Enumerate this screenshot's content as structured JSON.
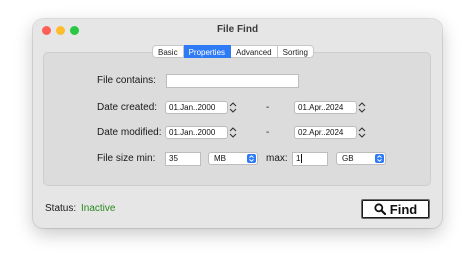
{
  "window": {
    "title": "File Find"
  },
  "tabs": [
    {
      "label": "Basic",
      "active": false
    },
    {
      "label": "Properties",
      "active": true
    },
    {
      "label": "Advanced",
      "active": false
    },
    {
      "label": "Sorting",
      "active": false
    }
  ],
  "form": {
    "file_contains": {
      "label": "File contains:",
      "value": ""
    },
    "date_created": {
      "label": "Date created:",
      "from": "01.Jan..2000",
      "to": "01.Apr..2024",
      "separator": "-"
    },
    "date_modified": {
      "label": "Date modified:",
      "from": "01.Jan..2000",
      "to": "02.Apr..2024",
      "separator": "-"
    },
    "file_size": {
      "min_label": "File size min:",
      "min_value": "35",
      "min_unit": "MB",
      "max_label": "max:",
      "max_value": "1",
      "max_unit": "GB"
    }
  },
  "status": {
    "label": "Status:",
    "value": "Inactive"
  },
  "find_button": {
    "label": "Find",
    "icon": "magnifier-icon"
  },
  "colors": {
    "accent": "#2f7bf6",
    "status_inactive": "#2a8a1f"
  }
}
